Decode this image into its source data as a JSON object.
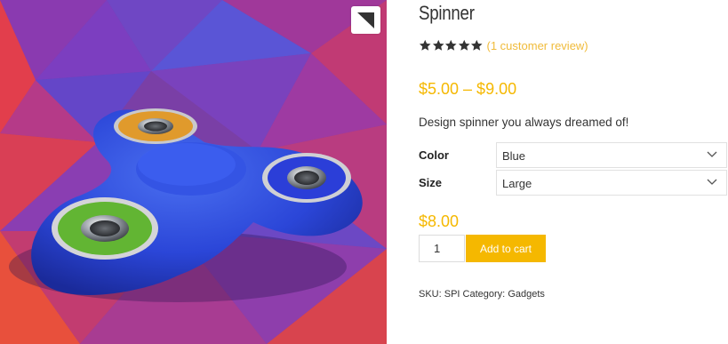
{
  "product": {
    "title": "Spinner",
    "rating": 5,
    "rating_max": 5,
    "review_link": "(1 customer review)",
    "price_range": "$5.00 – $9.00",
    "description": "Design spinner you always dreamed of!",
    "variations": [
      {
        "label": "Color",
        "selected": "Blue"
      },
      {
        "label": "Size",
        "selected": "Large"
      }
    ],
    "selected_price": "$8.00",
    "quantity": "1",
    "add_to_cart_label": "Add to cart",
    "sku_label": "SKU:",
    "sku_value": "SPI",
    "category_label": "Category:",
    "category_value": "Gadgets"
  },
  "gallery": {
    "image_subject": "fidget-spinner-image",
    "zoom_icon": "zoom-icon"
  },
  "colors": {
    "accent": "#f5b800",
    "review_link": "#f0bb3a",
    "star": "#333333"
  }
}
